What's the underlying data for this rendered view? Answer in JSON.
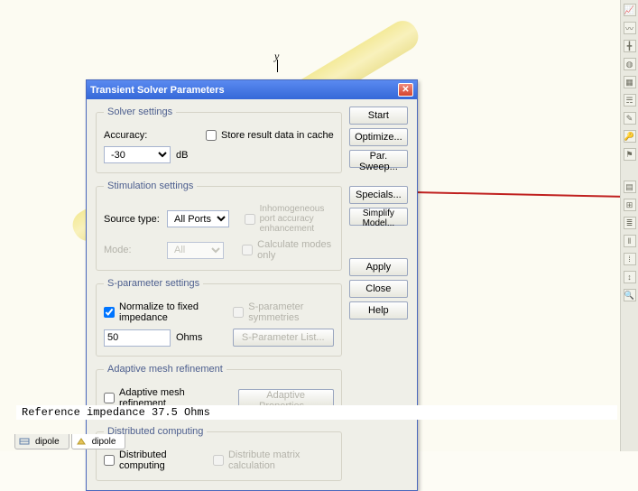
{
  "dialog": {
    "title": "Transient Solver Parameters",
    "solver": {
      "legend": "Solver settings",
      "accuracy_label": "Accuracy:",
      "accuracy_value": "-30",
      "unit": "dB",
      "store_cache": "Store result data in cache"
    },
    "stim": {
      "legend": "Stimulation settings",
      "source_label": "Source type:",
      "source_value": "All Ports",
      "mode_label": "Mode:",
      "mode_value": "All",
      "inhom": "Inhomogeneous port accuracy enhancement",
      "calc_modes": "Calculate modes only"
    },
    "sparam": {
      "legend": "S-parameter settings",
      "normalize": "Normalize to fixed impedance",
      "z_value": "50",
      "z_unit": "Ohms",
      "sym": "S-parameter symmetries",
      "list": "S-Parameter List..."
    },
    "adapt": {
      "legend": "Adaptive mesh refinement",
      "chk": "Adaptive mesh refinement",
      "btn": "Adaptive Properties..."
    },
    "dist": {
      "legend": "Distributed computing",
      "chk": "Distributed computing",
      "matrix": "Distribute matrix calculation"
    },
    "buttons": {
      "start": "Start",
      "optimize": "Optimize...",
      "parsweep": "Par. Sweep...",
      "specials": "Specials...",
      "simplify": "Simplify Model...",
      "apply": "Apply",
      "close": "Close",
      "help": "Help"
    }
  },
  "ref_impedance": "Reference impedance  37.5 Ohms",
  "tabs": {
    "t1": "dipole",
    "t2": "dipole"
  },
  "axis_y": "y"
}
